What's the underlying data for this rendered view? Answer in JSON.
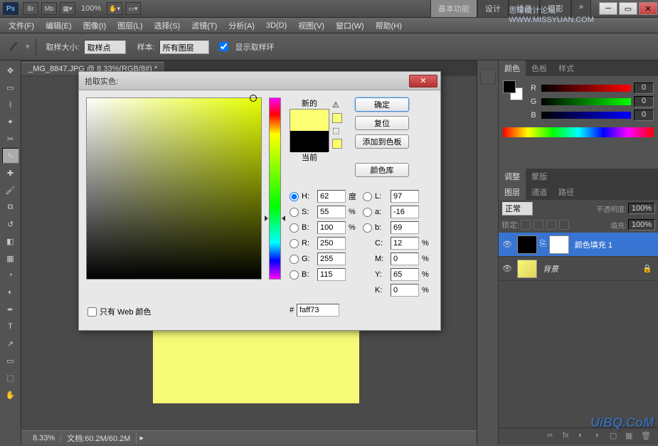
{
  "titlebar": {
    "zoom": "100%",
    "ws_basic": "基本功能",
    "ws_design": "设计",
    "ws_paint": "绘画",
    "ws_photo": "摄影",
    "wm2": "思缘设计论坛",
    "wm2b": "WWW.MISSYUAN.COM"
  },
  "menubar": [
    "文件(F)",
    "编辑(E)",
    "图像(I)",
    "图层(L)",
    "选择(S)",
    "滤镜(T)",
    "分析(A)",
    "3D(D)",
    "视图(V)",
    "窗口(W)",
    "帮助(H)"
  ],
  "optbar": {
    "sample_size": "取样大小:",
    "sample_point": "取样点",
    "sample_label": "样本:",
    "all_layers": "所有图层",
    "show_ring": "显示取样环"
  },
  "doc_tab": "_MG_8847.JPG @ 8.33%(RGB/8#) *",
  "status": {
    "zoom": "8.33%",
    "doc": "文档:60.2M/60.2M"
  },
  "panels": {
    "color": {
      "tab_color": "颜色",
      "tab_swatch": "色板",
      "tab_style": "样式",
      "r": "R",
      "g": "G",
      "b": "B",
      "rv": "0",
      "gv": "0",
      "bv": "0"
    },
    "adj": {
      "tab_adj": "调整",
      "tab_mask": "蒙版"
    },
    "layers": {
      "tab_layers": "图层",
      "tab_channels": "通道",
      "tab_paths": "路径",
      "blend": "正常",
      "opacity_lbl": "不透明度:",
      "opacity": "100%",
      "lock_lbl": "锁定:",
      "fill_lbl": "填充:",
      "fill": "100%",
      "layer1": "颜色填充 1",
      "layer_bg": "背景"
    }
  },
  "dialog": {
    "title": "拾取实色:",
    "new_lbl": "新的",
    "cur_lbl": "当前",
    "btn_ok": "确定",
    "btn_reset": "复位",
    "btn_add": "添加到色板",
    "btn_lib": "颜色库",
    "H": "H:",
    "Hv": "62",
    "Hu": "度",
    "S": "S:",
    "Sv": "55",
    "Su": "%",
    "Bb": "B:",
    "Bv": "100",
    "Bu": "%",
    "L": "L:",
    "Lv": "97",
    "a": "a:",
    "av": "-16",
    "b": "b:",
    "bv": "69",
    "R": "R:",
    "Rv": "250",
    "G": "G:",
    "Gv": "255",
    "Bc": "B:",
    "Bcv": "115",
    "C": "C:",
    "Cv": "12",
    "M": "M:",
    "Mv": "0",
    "Y": "Y:",
    "Yv": "65",
    "K": "K:",
    "Kv": "0",
    "pct": "%",
    "hex_lbl": "#",
    "hex": "faff73",
    "web_only": "只有 Web 颜色"
  },
  "watermark": "UiBQ.CoM"
}
